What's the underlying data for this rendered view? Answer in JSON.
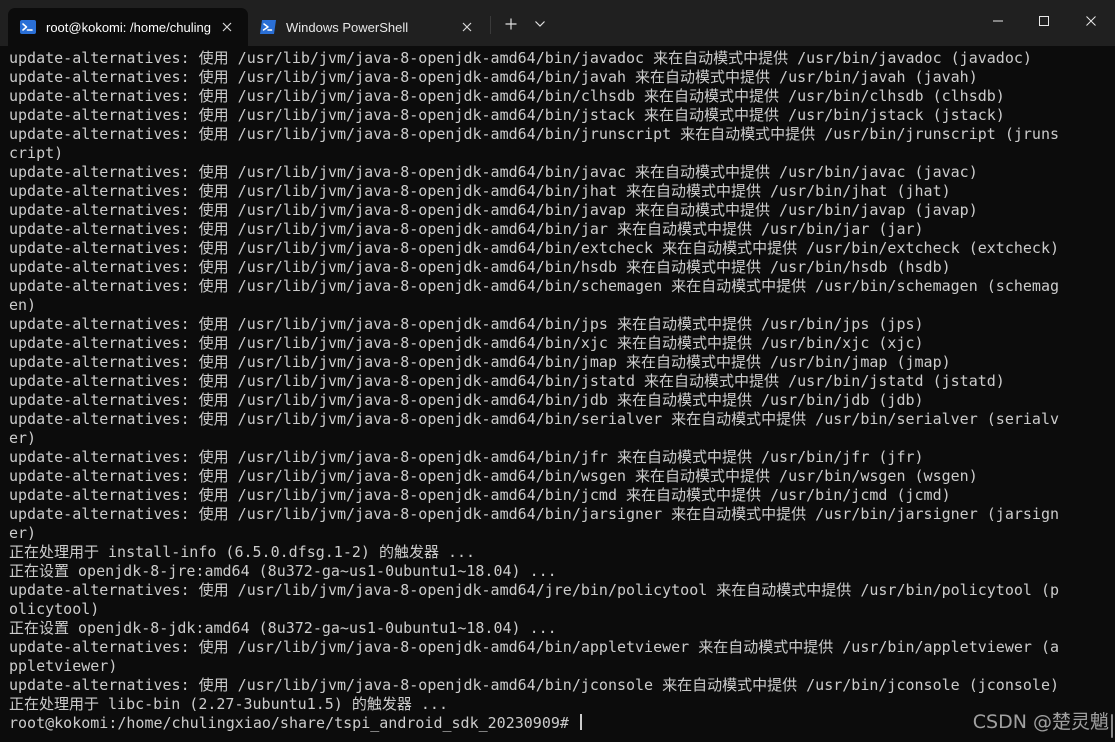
{
  "colors": {
    "titlebar_bg": "#202020",
    "terminal_bg": "#0c0c0c",
    "terminal_fg": "#cccccc",
    "accent": "#2a6fd6"
  },
  "tabs": [
    {
      "title": "root@kokomi: /home/chuling",
      "icon": "linux-terminal-icon",
      "active": true
    },
    {
      "title": "Windows PowerShell",
      "icon": "powershell-icon",
      "active": false
    }
  ],
  "terminal": {
    "lines": [
      "update-alternatives: 使用 /usr/lib/jvm/java-8-openjdk-amd64/bin/javadoc 来在自动模式中提供 /usr/bin/javadoc (javadoc)",
      "update-alternatives: 使用 /usr/lib/jvm/java-8-openjdk-amd64/bin/javah 来在自动模式中提供 /usr/bin/javah (javah)",
      "update-alternatives: 使用 /usr/lib/jvm/java-8-openjdk-amd64/bin/clhsdb 来在自动模式中提供 /usr/bin/clhsdb (clhsdb)",
      "update-alternatives: 使用 /usr/lib/jvm/java-8-openjdk-amd64/bin/jstack 来在自动模式中提供 /usr/bin/jstack (jstack)",
      "update-alternatives: 使用 /usr/lib/jvm/java-8-openjdk-amd64/bin/jrunscript 来在自动模式中提供 /usr/bin/jrunscript (jruns",
      "cript)",
      "update-alternatives: 使用 /usr/lib/jvm/java-8-openjdk-amd64/bin/javac 来在自动模式中提供 /usr/bin/javac (javac)",
      "update-alternatives: 使用 /usr/lib/jvm/java-8-openjdk-amd64/bin/jhat 来在自动模式中提供 /usr/bin/jhat (jhat)",
      "update-alternatives: 使用 /usr/lib/jvm/java-8-openjdk-amd64/bin/javap 来在自动模式中提供 /usr/bin/javap (javap)",
      "update-alternatives: 使用 /usr/lib/jvm/java-8-openjdk-amd64/bin/jar 来在自动模式中提供 /usr/bin/jar (jar)",
      "update-alternatives: 使用 /usr/lib/jvm/java-8-openjdk-amd64/bin/extcheck 来在自动模式中提供 /usr/bin/extcheck (extcheck)",
      "update-alternatives: 使用 /usr/lib/jvm/java-8-openjdk-amd64/bin/hsdb 来在自动模式中提供 /usr/bin/hsdb (hsdb)",
      "update-alternatives: 使用 /usr/lib/jvm/java-8-openjdk-amd64/bin/schemagen 来在自动模式中提供 /usr/bin/schemagen (schemag",
      "en)",
      "update-alternatives: 使用 /usr/lib/jvm/java-8-openjdk-amd64/bin/jps 来在自动模式中提供 /usr/bin/jps (jps)",
      "update-alternatives: 使用 /usr/lib/jvm/java-8-openjdk-amd64/bin/xjc 来在自动模式中提供 /usr/bin/xjc (xjc)",
      "update-alternatives: 使用 /usr/lib/jvm/java-8-openjdk-amd64/bin/jmap 来在自动模式中提供 /usr/bin/jmap (jmap)",
      "update-alternatives: 使用 /usr/lib/jvm/java-8-openjdk-amd64/bin/jstatd 来在自动模式中提供 /usr/bin/jstatd (jstatd)",
      "update-alternatives: 使用 /usr/lib/jvm/java-8-openjdk-amd64/bin/jdb 来在自动模式中提供 /usr/bin/jdb (jdb)",
      "update-alternatives: 使用 /usr/lib/jvm/java-8-openjdk-amd64/bin/serialver 来在自动模式中提供 /usr/bin/serialver (serialv",
      "er)",
      "update-alternatives: 使用 /usr/lib/jvm/java-8-openjdk-amd64/bin/jfr 来在自动模式中提供 /usr/bin/jfr (jfr)",
      "update-alternatives: 使用 /usr/lib/jvm/java-8-openjdk-amd64/bin/wsgen 来在自动模式中提供 /usr/bin/wsgen (wsgen)",
      "update-alternatives: 使用 /usr/lib/jvm/java-8-openjdk-amd64/bin/jcmd 来在自动模式中提供 /usr/bin/jcmd (jcmd)",
      "update-alternatives: 使用 /usr/lib/jvm/java-8-openjdk-amd64/bin/jarsigner 来在自动模式中提供 /usr/bin/jarsigner (jarsign",
      "er)",
      "正在处理用于 install-info (6.5.0.dfsg.1-2) 的触发器 ...",
      "正在设置 openjdk-8-jre:amd64 (8u372-ga~us1-0ubuntu1~18.04) ...",
      "update-alternatives: 使用 /usr/lib/jvm/java-8-openjdk-amd64/jre/bin/policytool 来在自动模式中提供 /usr/bin/policytool (p",
      "olicytool)",
      "正在设置 openjdk-8-jdk:amd64 (8u372-ga~us1-0ubuntu1~18.04) ...",
      "update-alternatives: 使用 /usr/lib/jvm/java-8-openjdk-amd64/bin/appletviewer 来在自动模式中提供 /usr/bin/appletviewer (a",
      "ppletviewer)",
      "update-alternatives: 使用 /usr/lib/jvm/java-8-openjdk-amd64/bin/jconsole 来在自动模式中提供 /usr/bin/jconsole (jconsole)",
      "正在处理用于 libc-bin (2.27-3ubuntu1.5) 的触发器 ..."
    ],
    "prompt": "root@kokomi:/home/chulingxiao/share/tspi_android_sdk_20230909# "
  },
  "watermark": "CSDN @楚灵魈"
}
